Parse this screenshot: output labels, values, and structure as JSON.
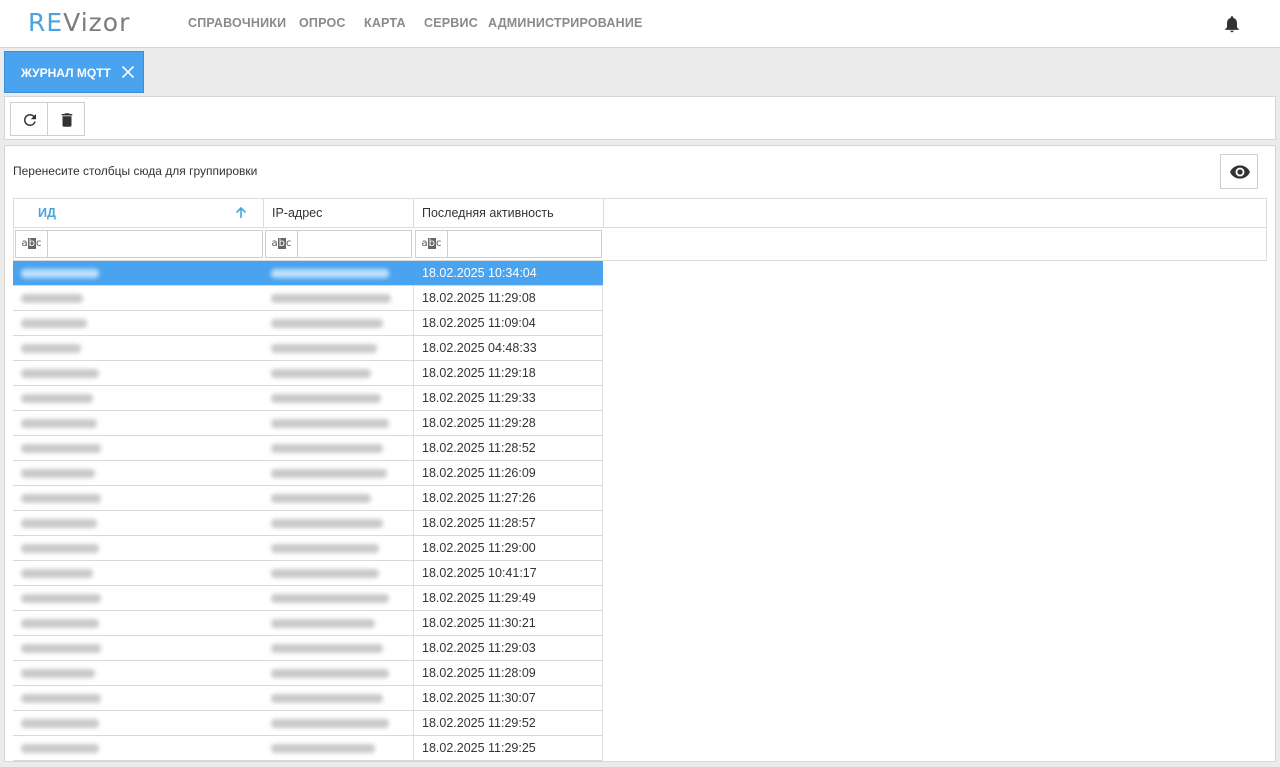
{
  "app": {
    "logo_re": "RE",
    "logo_vizor": "Vizor",
    "nav": [
      "СПРАВОЧНИКИ",
      "ОПРОС",
      "КАРТА",
      "СЕРВИС",
      "АДМИНИСТРИРОВАНИЕ"
    ],
    "bell_icon": "bell-icon"
  },
  "tab": {
    "label": "ЖУРНАЛ MQTT",
    "close_icon": "close-icon"
  },
  "toolbar": {
    "refresh_icon": "refresh-icon",
    "delete_icon": "trash-icon"
  },
  "grid": {
    "group_hint": "Перенесите столбцы сюда для группировки",
    "columns": [
      "ИД",
      "IP-адрес",
      "Последняя активность"
    ],
    "sort": {
      "column": "ИД",
      "direction": "ascending"
    },
    "filter_placeholder": "",
    "column_chooser_icon": "eye-icon",
    "rows": [
      {
        "id": "",
        "ip": "",
        "last_activity": "18.02.2025 10:34:04",
        "selected": true
      },
      {
        "id": "",
        "ip": "",
        "last_activity": "18.02.2025 11:29:08"
      },
      {
        "id": "",
        "ip": "",
        "last_activity": "18.02.2025 11:09:04"
      },
      {
        "id": "",
        "ip": "",
        "last_activity": "18.02.2025 04:48:33"
      },
      {
        "id": "",
        "ip": "",
        "last_activity": "18.02.2025 11:29:18"
      },
      {
        "id": "",
        "ip": "",
        "last_activity": "18.02.2025 11:29:33"
      },
      {
        "id": "",
        "ip": "",
        "last_activity": "18.02.2025 11:29:28"
      },
      {
        "id": "",
        "ip": "",
        "last_activity": "18.02.2025 11:28:52"
      },
      {
        "id": "",
        "ip": "",
        "last_activity": "18.02.2025 11:26:09"
      },
      {
        "id": "",
        "ip": "",
        "last_activity": "18.02.2025 11:27:26"
      },
      {
        "id": "",
        "ip": "",
        "last_activity": "18.02.2025 11:28:57"
      },
      {
        "id": "",
        "ip": "",
        "last_activity": "18.02.2025 11:29:00"
      },
      {
        "id": "",
        "ip": "",
        "last_activity": "18.02.2025 10:41:17"
      },
      {
        "id": "",
        "ip": "",
        "last_activity": "18.02.2025 11:29:49"
      },
      {
        "id": "",
        "ip": "",
        "last_activity": "18.02.2025 11:30:21"
      },
      {
        "id": "",
        "ip": "",
        "last_activity": "18.02.2025 11:29:03"
      },
      {
        "id": "",
        "ip": "",
        "last_activity": "18.02.2025 11:28:09"
      },
      {
        "id": "",
        "ip": "",
        "last_activity": "18.02.2025 11:30:07"
      },
      {
        "id": "",
        "ip": "",
        "last_activity": "18.02.2025 11:29:52"
      },
      {
        "id": "",
        "ip": "",
        "last_activity": "18.02.2025 11:29:25"
      }
    ]
  }
}
